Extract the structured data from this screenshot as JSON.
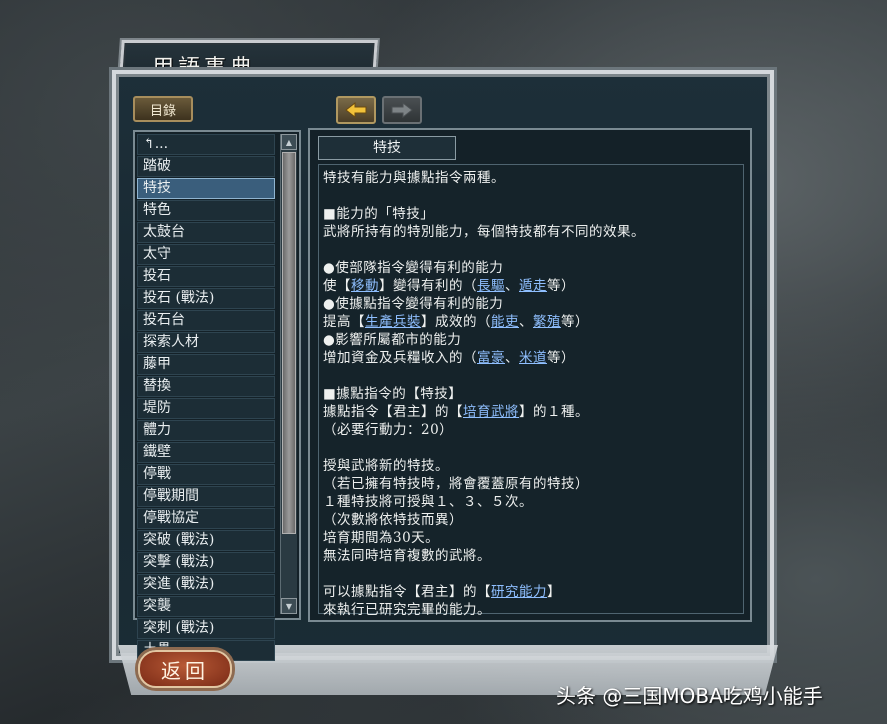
{
  "window": {
    "title": "用語事典"
  },
  "toolbar": {
    "contents_label": "目錄",
    "back_arrow": "arrow-left-icon",
    "forward_arrow": "arrow-right-icon"
  },
  "list": {
    "items": [
      {
        "label": "↰..."
      },
      {
        "label": "踏破"
      },
      {
        "label": "特技",
        "selected": true
      },
      {
        "label": "特色"
      },
      {
        "label": "太鼓台"
      },
      {
        "label": "太守"
      },
      {
        "label": "投石"
      },
      {
        "label": "投石 (戰法)"
      },
      {
        "label": "投石台"
      },
      {
        "label": "探索人材"
      },
      {
        "label": "藤甲"
      },
      {
        "label": "替換"
      },
      {
        "label": "堤防"
      },
      {
        "label": "體力"
      },
      {
        "label": "鐵壁"
      },
      {
        "label": "停戰"
      },
      {
        "label": "停戰期間"
      },
      {
        "label": "停戰協定"
      },
      {
        "label": "突破 (戰法)"
      },
      {
        "label": "突擊 (戰法)"
      },
      {
        "label": "突進 (戰法)"
      },
      {
        "label": "突襲"
      },
      {
        "label": "突刺 (戰法)"
      },
      {
        "label": "土壘"
      }
    ]
  },
  "entry": {
    "title": "特技",
    "lines": [
      [
        {
          "t": "特技有能力與據點指令兩種。"
        }
      ],
      [],
      [
        {
          "t": "■能力的「特技」"
        }
      ],
      [
        {
          "t": "武將所持有的特別能力，每個特技都有不同的效果。"
        }
      ],
      [],
      [
        {
          "t": "●使部隊指令變得有利的能力"
        }
      ],
      [
        {
          "t": "使【"
        },
        {
          "t": "移動",
          "link": true
        },
        {
          "t": "】變得有利的（"
        },
        {
          "t": "長驅",
          "link": true
        },
        {
          "t": "、"
        },
        {
          "t": "遁走",
          "link": true
        },
        {
          "t": "等）"
        }
      ],
      [
        {
          "t": "●使據點指令變得有利的能力"
        }
      ],
      [
        {
          "t": "提高【"
        },
        {
          "t": "生產兵裝",
          "link": true
        },
        {
          "t": "】成效的（"
        },
        {
          "t": "能吏",
          "link": true
        },
        {
          "t": "、"
        },
        {
          "t": "繁殖",
          "link": true
        },
        {
          "t": "等）"
        }
      ],
      [
        {
          "t": "●影響所屬都市的能力"
        }
      ],
      [
        {
          "t": "增加資金及兵糧收入的（"
        },
        {
          "t": "富豪",
          "link": true
        },
        {
          "t": "、"
        },
        {
          "t": "米道",
          "link": true
        },
        {
          "t": "等）"
        }
      ],
      [],
      [
        {
          "t": "■據點指令的【特技】"
        }
      ],
      [
        {
          "t": "據點指令【君主】的【"
        },
        {
          "t": "培育武將",
          "link": true
        },
        {
          "t": "】的１種。"
        }
      ],
      [
        {
          "t": "（必要行動力：20）"
        }
      ],
      [],
      [
        {
          "t": "授與武將新的特技。"
        }
      ],
      [
        {
          "t": "（若已擁有特技時，將會覆蓋原有的特技）"
        }
      ],
      [
        {
          "t": "１種特技將可授與１、３、５次。"
        }
      ],
      [
        {
          "t": "（次數將依特技而異）"
        }
      ],
      [
        {
          "t": "培育期間為30天。"
        }
      ],
      [
        {
          "t": "無法同時培育複數的武將。"
        }
      ],
      [],
      [
        {
          "t": "可以據點指令【君主】的【"
        },
        {
          "t": "研究能力",
          "link": true
        },
        {
          "t": "】"
        }
      ],
      [
        {
          "t": "來執行已研究完畢的能力。"
        }
      ]
    ]
  },
  "footer": {
    "return_label": "返回"
  },
  "watermark": "头条 @三国MOBA吃鸡小能手"
}
